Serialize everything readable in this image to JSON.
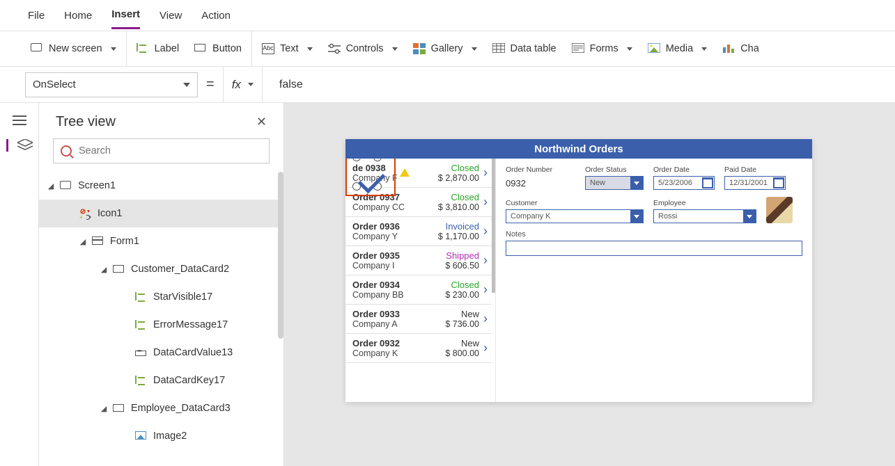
{
  "menu": {
    "items": [
      "File",
      "Home",
      "Insert",
      "View",
      "Action"
    ],
    "active": "Insert"
  },
  "ribbon": {
    "newScreen": "New screen",
    "label": "Label",
    "button": "Button",
    "text": "Text",
    "controls": "Controls",
    "gallery": "Gallery",
    "dataTable": "Data table",
    "forms": "Forms",
    "media": "Media",
    "charts": "Cha"
  },
  "formula": {
    "property": "OnSelect",
    "fx": "fx",
    "value": "false"
  },
  "tree": {
    "title": "Tree view",
    "searchPlaceholder": "Search",
    "nodes": {
      "screen1": "Screen1",
      "icon1": "Icon1",
      "form1": "Form1",
      "customerCard": "Customer_DataCard2",
      "starVisible": "StarVisible17",
      "errorMessage": "ErrorMessage17",
      "dataCardValue": "DataCardValue13",
      "dataCardKey": "DataCardKey17",
      "employeeCard": "Employee_DataCard3",
      "image2": "Image2"
    }
  },
  "app": {
    "title": "Northwind Orders",
    "orders": [
      {
        "title": "   de  0938",
        "company": "Company F",
        "status": "Closed",
        "statusClass": "closed",
        "amount": "$ 2,870.00"
      },
      {
        "title": "Order 0937",
        "company": "Company CC",
        "status": "Closed",
        "statusClass": "closed",
        "amount": "$ 3,810.00"
      },
      {
        "title": "Order 0936",
        "company": "Company Y",
        "status": "Invoiced",
        "statusClass": "invoiced",
        "amount": "$ 1,170.00"
      },
      {
        "title": "Order 0935",
        "company": "Company I",
        "status": "Shipped",
        "statusClass": "shipped",
        "amount": "$ 606.50"
      },
      {
        "title": "Order 0934",
        "company": "Company BB",
        "status": "Closed",
        "statusClass": "closed",
        "amount": "$ 230.00"
      },
      {
        "title": "Order 0933",
        "company": "Company A",
        "status": "New",
        "statusClass": "new",
        "amount": "$ 736.00"
      },
      {
        "title": "Order 0932",
        "company": "Company K",
        "status": "New",
        "statusClass": "new",
        "amount": "$ 800.00"
      }
    ],
    "form": {
      "orderNumberLabel": "Order Number",
      "orderNumber": "0932",
      "orderStatusLabel": "Order Status",
      "orderStatus": "New",
      "orderDateLabel": "Order Date",
      "orderDate": "5/23/2006",
      "paidDateLabel": "Paid Date",
      "paidDate": "12/31/2001",
      "customerLabel": "Customer",
      "customer": "Company K",
      "employeeLabel": "Employee",
      "employee": "Rossi",
      "notesLabel": "Notes"
    }
  }
}
